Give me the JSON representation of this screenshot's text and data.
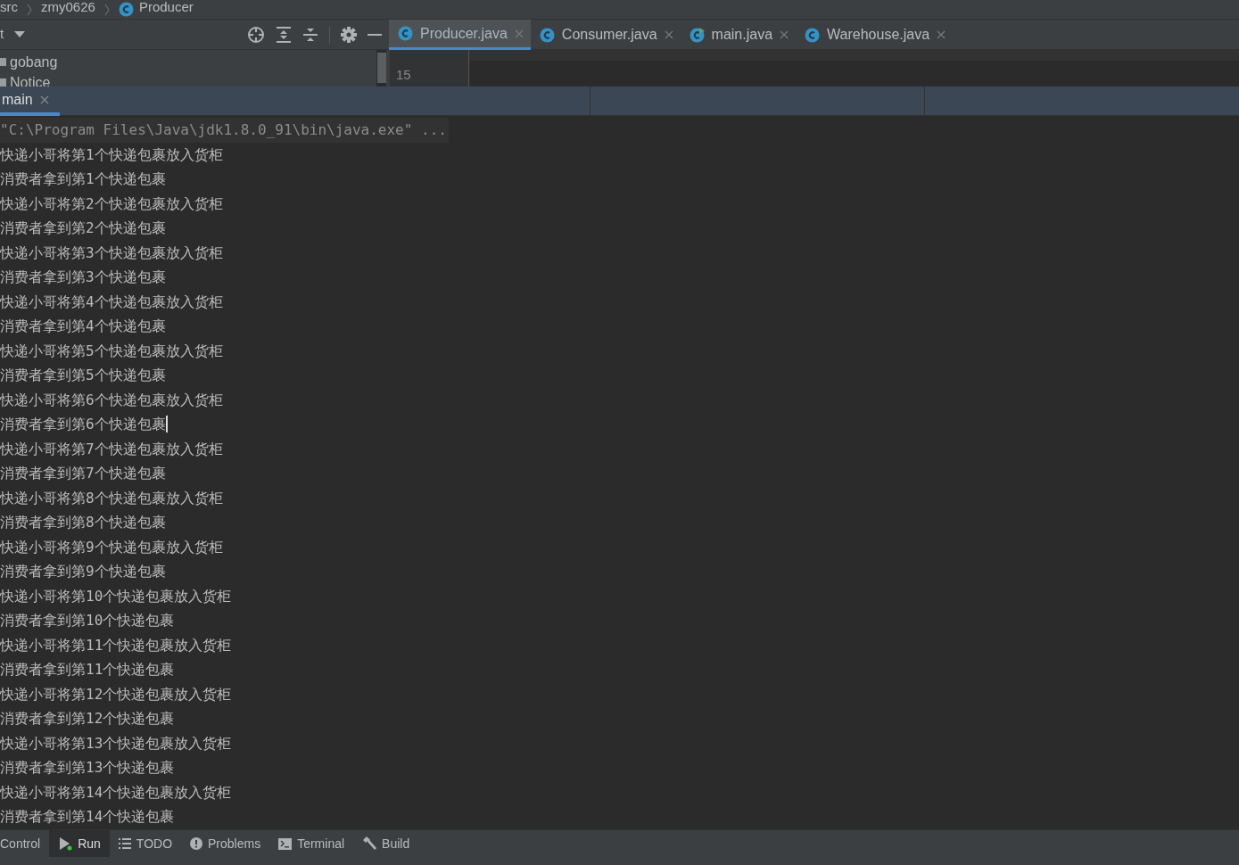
{
  "breadcrumbs": [
    {
      "label": "src",
      "kind": "folder"
    },
    {
      "label": "zmy0626",
      "kind": "folder"
    },
    {
      "label": "Producer",
      "kind": "class"
    }
  ],
  "project_panel": {
    "title": "t",
    "items": [
      {
        "label": "gobang"
      },
      {
        "label": "Notice"
      }
    ]
  },
  "editor_tabs": [
    {
      "label": "Producer.java",
      "selected": true,
      "kind": "class"
    },
    {
      "label": "Consumer.java",
      "selected": false,
      "kind": "class"
    },
    {
      "label": "main.java",
      "selected": false,
      "kind": "runnable"
    },
    {
      "label": "Warehouse.java",
      "selected": false,
      "kind": "class"
    }
  ],
  "gutter_lines": [
    "15"
  ],
  "run_tabs": [
    {
      "label": "main",
      "selected": true
    }
  ],
  "console": {
    "command": "\"C:\\Program Files\\Java\\jdk1.8.0_91\\bin\\java.exe\" ...",
    "lines": [
      {
        "text": "快递小哥将第1个快递包裹放入货柜",
        "cursor": false
      },
      {
        "text": "消费者拿到第1个快递包裹",
        "cursor": false
      },
      {
        "text": "快递小哥将第2个快递包裹放入货柜",
        "cursor": false
      },
      {
        "text": "消费者拿到第2个快递包裹",
        "cursor": false
      },
      {
        "text": "快递小哥将第3个快递包裹放入货柜",
        "cursor": false
      },
      {
        "text": "消费者拿到第3个快递包裹",
        "cursor": false
      },
      {
        "text": "快递小哥将第4个快递包裹放入货柜",
        "cursor": false
      },
      {
        "text": "消费者拿到第4个快递包裹",
        "cursor": false
      },
      {
        "text": "快递小哥将第5个快递包裹放入货柜",
        "cursor": false
      },
      {
        "text": "消费者拿到第5个快递包裹",
        "cursor": false
      },
      {
        "text": "快递小哥将第6个快递包裹放入货柜",
        "cursor": false
      },
      {
        "text": "消费者拿到第6个快递包裹",
        "cursor": true
      },
      {
        "text": "快递小哥将第7个快递包裹放入货柜",
        "cursor": false
      },
      {
        "text": "消费者拿到第7个快递包裹",
        "cursor": false
      },
      {
        "text": "快递小哥将第8个快递包裹放入货柜",
        "cursor": false
      },
      {
        "text": "消费者拿到第8个快递包裹",
        "cursor": false
      },
      {
        "text": "快递小哥将第9个快递包裹放入货柜",
        "cursor": false
      },
      {
        "text": "消费者拿到第9个快递包裹",
        "cursor": false
      },
      {
        "text": "快递小哥将第10个快递包裹放入货柜",
        "cursor": false
      },
      {
        "text": "消费者拿到第10个快递包裹",
        "cursor": false
      },
      {
        "text": "快递小哥将第11个快递包裹放入货柜",
        "cursor": false
      },
      {
        "text": "消费者拿到第11个快递包裹",
        "cursor": false
      },
      {
        "text": "快递小哥将第12个快递包裹放入货柜",
        "cursor": false
      },
      {
        "text": "消费者拿到第12个快递包裹",
        "cursor": false
      },
      {
        "text": "快递小哥将第13个快递包裹放入货柜",
        "cursor": false
      },
      {
        "text": "消费者拿到第13个快递包裹",
        "cursor": false
      },
      {
        "text": "快递小哥将第14个快递包裹放入货柜",
        "cursor": false
      },
      {
        "text": "消费者拿到第14个快递包裹",
        "cursor": false
      }
    ]
  },
  "bottom_tabs": [
    {
      "label": "Control",
      "kind": "plain",
      "selected": false
    },
    {
      "label": "Run",
      "kind": "run",
      "selected": true
    },
    {
      "label": "TODO",
      "kind": "list",
      "selected": false
    },
    {
      "label": "Problems",
      "kind": "problems",
      "selected": false
    },
    {
      "label": "Terminal",
      "kind": "terminal",
      "selected": false
    },
    {
      "label": "Build",
      "kind": "build",
      "selected": false
    }
  ]
}
